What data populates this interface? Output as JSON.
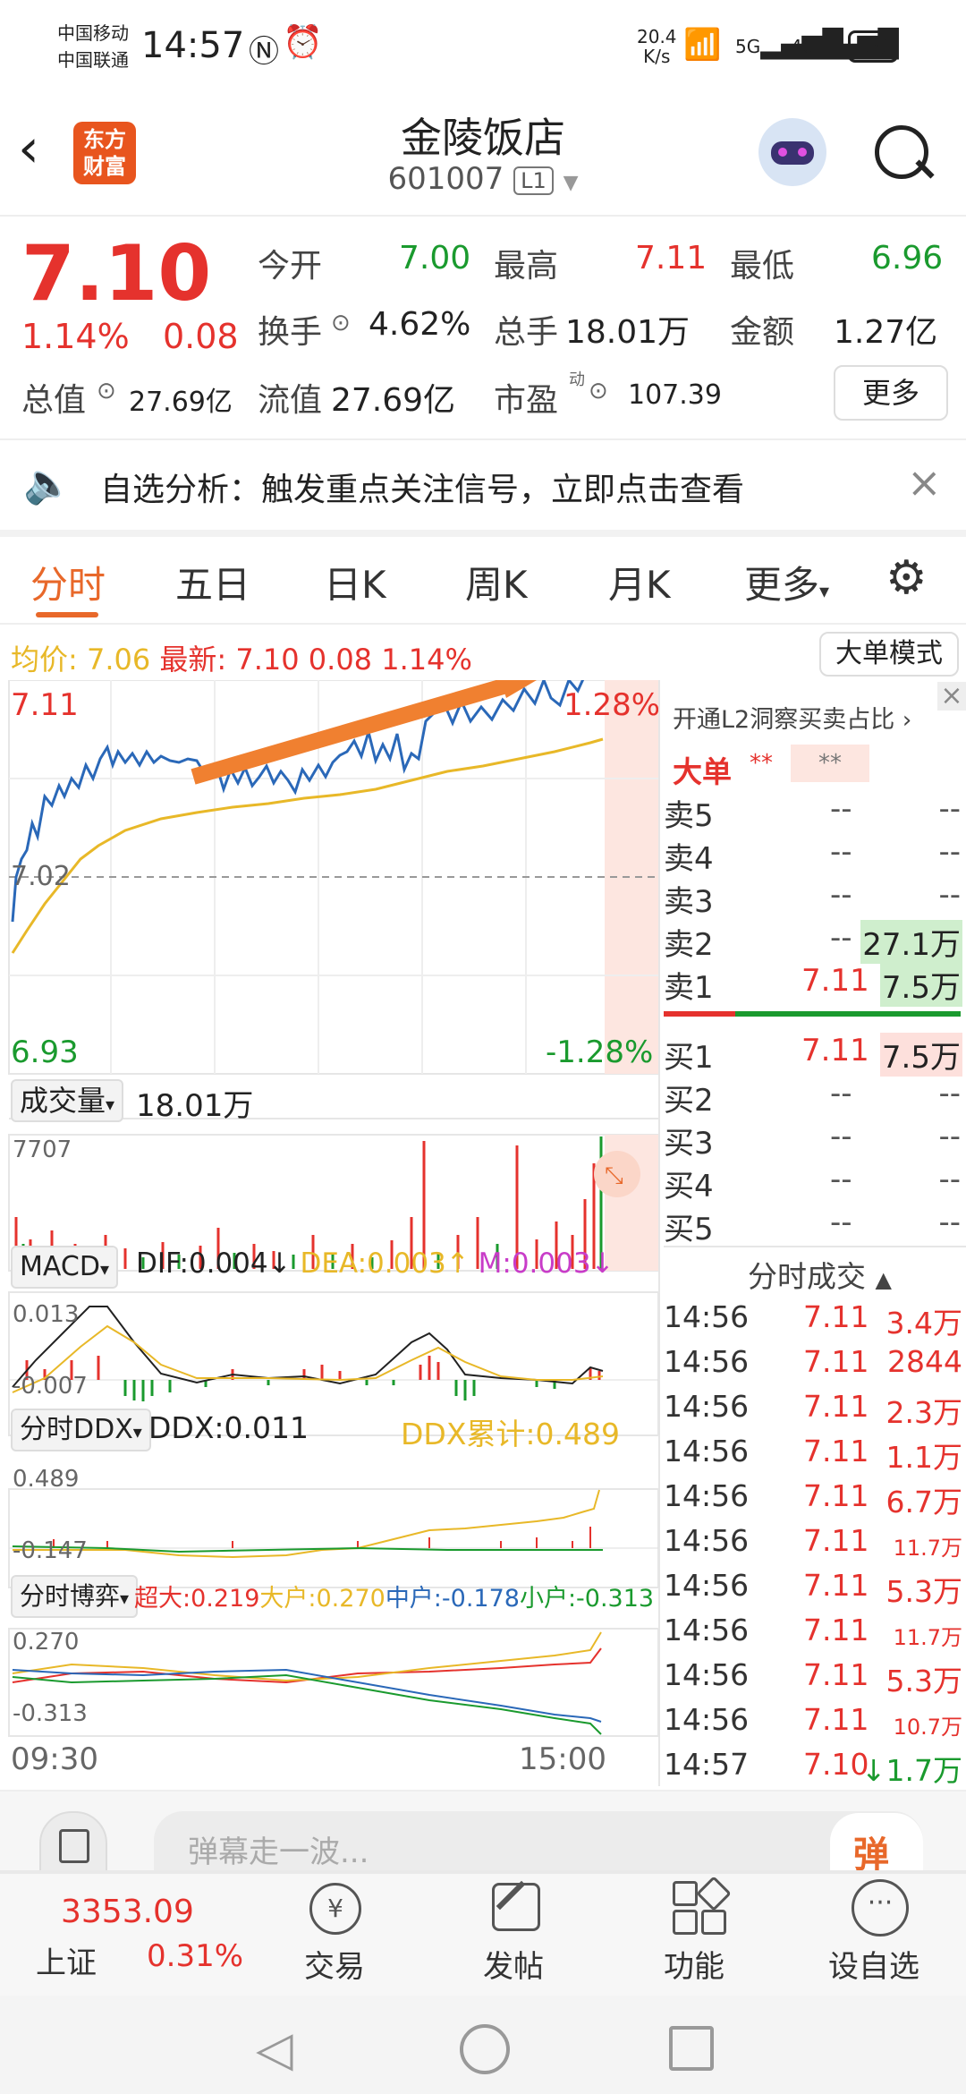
{
  "status_bar": {
    "carrier1": "中国移动",
    "carrier2": "中国联通",
    "time": "14:57",
    "speed_top": "20.4",
    "speed_unit": "K/s",
    "net1": "5G",
    "net2": "4G",
    "battery": "19"
  },
  "header": {
    "logo_line1": "东方",
    "logo_line2": "财富",
    "title": "金陵饭店",
    "code": "601007",
    "level": "L1"
  },
  "quote": {
    "price": "7.10",
    "change_pct": "1.14%",
    "change": "0.08",
    "open_label": "今开",
    "open": "7.00",
    "high_label": "最高",
    "high": "7.11",
    "low_label": "最低",
    "low": "6.96",
    "turnover_label": "换手",
    "turnover": "4.62%",
    "volume_label": "总手",
    "volume": "18.01万",
    "amount_label": "金额",
    "amount": "1.27亿",
    "mktcap_label": "总值",
    "mktcap": "27.69亿",
    "float_label": "流值",
    "float": "27.69亿",
    "pe_label": "市盈",
    "pe_sup": "动",
    "pe": "107.39",
    "more_button": "更多"
  },
  "banner": {
    "text": "自选分析：触发重点关注信号，立即点击查看"
  },
  "tabs": [
    "分时",
    "五日",
    "日K",
    "周K",
    "月K",
    "更多"
  ],
  "chart_info": {
    "avg_label": "均价:",
    "avg": "7.06",
    "latest_label": "最新:",
    "latest": "7.10",
    "chg": "0.08",
    "chg_pct": "1.14%",
    "mode_button": "大单模式"
  },
  "price_axis": {
    "top": "7.11",
    "mid": "7.02",
    "bottom": "6.93",
    "top_pct": "1.28%",
    "bottom_pct": "-1.28%"
  },
  "volume_panel": {
    "selector": "成交量",
    "value": "18.01万",
    "max": "7707"
  },
  "macd_panel": {
    "selector": "MACD",
    "dif": "DIF:0.004↓",
    "dea": "DEA:0.003↑",
    "m": "M:0.003↓",
    "top": "0.013",
    "bottom": "-0.007"
  },
  "ddx_panel": {
    "selector": "分时DDX",
    "ddx": "DDX:0.011",
    "ddx_total": "DDX累计:0.489",
    "top": "0.489",
    "bottom": "-0.147"
  },
  "game_panel": {
    "selector": "分时博弈",
    "super": "超大:0.219",
    "big": "大户:0.270",
    "mid": "中户:-0.178",
    "small": "小户:-0.313",
    "top": "0.270",
    "bottom": "-0.313"
  },
  "time_axis": {
    "start": "09:30",
    "end": "15:00"
  },
  "orderbook": {
    "l2_text": "开通L2洞察买卖占比",
    "big_label": "大单",
    "big_val1": "**",
    "big_val2": "**",
    "asks": [
      {
        "label": "卖5",
        "price": "--",
        "vol": "--"
      },
      {
        "label": "卖4",
        "price": "--",
        "vol": "--"
      },
      {
        "label": "卖3",
        "price": "--",
        "vol": "--"
      },
      {
        "label": "卖2",
        "price": "--",
        "vol": "27.1万"
      },
      {
        "label": "卖1",
        "price": "7.11",
        "vol": "7.5万"
      }
    ],
    "bids": [
      {
        "label": "买1",
        "price": "7.11",
        "vol": "7.5万"
      },
      {
        "label": "买2",
        "price": "--",
        "vol": "--"
      },
      {
        "label": "买3",
        "price": "--",
        "vol": "--"
      },
      {
        "label": "买4",
        "price": "--",
        "vol": "--"
      },
      {
        "label": "买5",
        "price": "--",
        "vol": "--"
      }
    ]
  },
  "trades": {
    "title": "分时成交",
    "rows": [
      {
        "time": "14:56",
        "price": "7.11",
        "vol": "3.4万"
      },
      {
        "time": "14:56",
        "price": "7.11",
        "vol": "2844"
      },
      {
        "time": "14:56",
        "price": "7.11",
        "vol": "2.3万"
      },
      {
        "time": "14:56",
        "price": "7.11",
        "vol": "1.1万"
      },
      {
        "time": "14:56",
        "price": "7.11",
        "vol": "6.7万"
      },
      {
        "time": "14:56",
        "price": "7.11",
        "vol": "11.7万"
      },
      {
        "time": "14:56",
        "price": "7.11",
        "vol": "5.3万"
      },
      {
        "time": "14:56",
        "price": "7.11",
        "vol": "11.7万"
      },
      {
        "time": "14:56",
        "price": "7.11",
        "vol": "5.3万"
      },
      {
        "time": "14:56",
        "price": "7.11",
        "vol": "10.7万"
      },
      {
        "time": "14:57",
        "price": "7.10",
        "vol": "↓1.7万"
      }
    ]
  },
  "danmu": {
    "placeholder": "弹幕走一波...",
    "button": "弹"
  },
  "bottom_bar": {
    "index_value": "3353.09",
    "index_name": "上证",
    "index_pct": "0.31%",
    "trade": "交易",
    "post": "发帖",
    "functions": "功能",
    "watchlist": "设自选"
  },
  "colors": {
    "up": "#e5322d",
    "down": "#1a9a2e",
    "accent": "#e8682a",
    "avg_line": "#e8b828",
    "price_line": "#2a68b8"
  }
}
